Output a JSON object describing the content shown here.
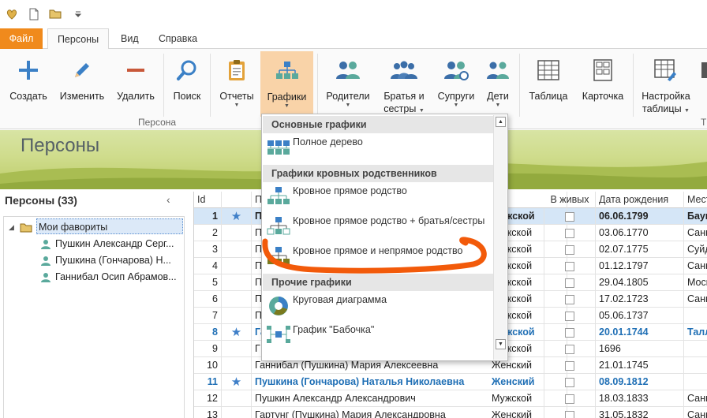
{
  "tabs": {
    "file": "Файл",
    "persons": "Персоны",
    "view": "Вид",
    "help": "Справка"
  },
  "ribbon": {
    "create": "Создать",
    "edit": "Изменить",
    "delete": "Удалить",
    "search": "Поиск",
    "reports": "Отчеты",
    "charts": "Графики",
    "parents": "Родители",
    "siblings_1": "Братья и",
    "siblings_2": "сестры",
    "spouses": "Супруги",
    "children": "Дети",
    "table": "Таблица",
    "card": "Карточка",
    "table_settings_1": "Настройка",
    "table_settings_2": "таблицы",
    "group_person": "Персона",
    "group_cut": "Т"
  },
  "banner": {
    "title": "Персоны"
  },
  "left_panel": {
    "header": "Персоны (33)",
    "favorites": "Мои фавориты",
    "people": [
      "Пушкин Александр Серг...",
      "Пушкина (Гончарова) Н...",
      "Ганнибал Осип Абрамов..."
    ]
  },
  "table": {
    "headers": {
      "id": "Id",
      "name": "П",
      "alive": "В живых",
      "birth": "Дата рождения",
      "place": "Мест"
    },
    "rows": [
      {
        "id": "1",
        "star": true,
        "name": "П",
        "sex": "Мужской",
        "birth": "06.06.1799",
        "place": "Баум"
      },
      {
        "id": "2",
        "star": false,
        "name": "П",
        "sex": "Мужской",
        "birth": "03.06.1770",
        "place": "Санк"
      },
      {
        "id": "3",
        "star": false,
        "name": "П",
        "sex": "Мужской",
        "birth": "02.07.1775",
        "place": "Суйд"
      },
      {
        "id": "4",
        "star": false,
        "name": "П",
        "sex": "Мужской",
        "birth": "01.12.1797",
        "place": "Санк"
      },
      {
        "id": "5",
        "star": false,
        "name": "П",
        "sex": "Мужской",
        "birth": "29.04.1805",
        "place": "Моск"
      },
      {
        "id": "6",
        "star": false,
        "name": "П",
        "sex": "Мужской",
        "birth": "17.02.1723",
        "place": "Санк"
      },
      {
        "id": "7",
        "star": false,
        "name": "П",
        "sex": "Мужской",
        "birth": "05.06.1737",
        "place": ""
      },
      {
        "id": "8",
        "star": true,
        "name": "Га",
        "sex": "Мужской",
        "birth": "20.01.1744",
        "place": "Талл"
      },
      {
        "id": "9",
        "star": false,
        "name": "Г",
        "sex": "Мужской",
        "birth": "1696",
        "place": ""
      },
      {
        "id": "10",
        "star": false,
        "name": "Ганнибал (Пушкина) Мария Алексеевна",
        "sex": "Женский",
        "birth": "21.01.1745",
        "place": ""
      },
      {
        "id": "11",
        "star": true,
        "name": "Пушкина (Гончарова) Наталья Николаевна",
        "sex": "Женский",
        "birth": "08.09.1812",
        "place": ""
      },
      {
        "id": "12",
        "star": false,
        "name": "Пушкин Александр Александрович",
        "sex": "Мужской",
        "birth": "18.03.1833",
        "place": "Санк"
      },
      {
        "id": "13",
        "star": false,
        "name": "Гартунг (Пушкина) Мария Александровна",
        "sex": "Женский",
        "birth": "31.05.1832",
        "place": "Санк"
      }
    ]
  },
  "menu": {
    "sec_basic": "Основные графики",
    "full_tree": "Полное дерево",
    "sec_blood": "Графики кровных родственников",
    "blood_direct": "Кровное прямое родство",
    "blood_direct_sib": "Кровное прямое родство + братья/сестры",
    "blood_direct_indirect": "Кровное прямое и непрямое родство",
    "sec_other": "Прочие графики",
    "pie": "Круговая диаграмма",
    "butterfly": "График \"Бабочка\""
  },
  "colors": {
    "accent_orange": "#f08a1c",
    "pressed": "#f9d3a8",
    "annotation": "#f25a0a",
    "link_blue": "#1f6fb5"
  }
}
